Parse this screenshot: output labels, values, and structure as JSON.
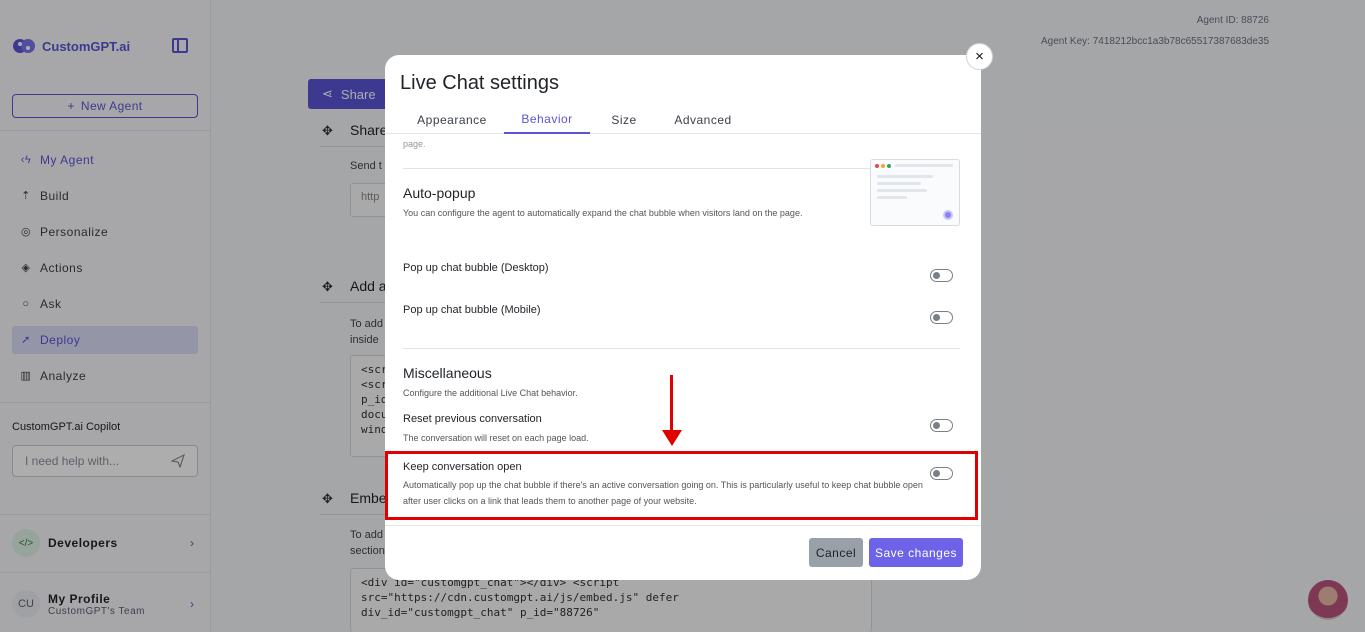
{
  "app": {
    "brand": "CustomGPT.ai",
    "accent": "#5a55d6"
  },
  "sidebar": {
    "new_agent": "New Agent",
    "nav": [
      {
        "label": "My Agent",
        "icon": "back-bolt-icon"
      },
      {
        "label": "Build",
        "icon": "build-icon"
      },
      {
        "label": "Personalize",
        "icon": "palette-icon"
      },
      {
        "label": "Actions",
        "icon": "actions-icon"
      },
      {
        "label": "Ask",
        "icon": "chat-icon"
      },
      {
        "label": "Deploy",
        "icon": "rocket-icon"
      },
      {
        "label": "Analyze",
        "icon": "chart-icon"
      }
    ],
    "copilot_title": "CustomGPT.ai Copilot",
    "copilot_placeholder": "I need help with...",
    "developers_badge": "</>",
    "developers": "Developers",
    "profile_initials": "CU",
    "profile_name": "My Profile",
    "profile_team": "CustomGPT's Team"
  },
  "header": {
    "agent_id": "Agent ID: 88726",
    "agent_key": "Agent Key: 7418212bcc1a3b78c65517387683de35"
  },
  "main": {
    "share_button": "Share",
    "section1_title": "Share",
    "section1_text": "Send t",
    "section1_input": "http",
    "section2_title": "Add a",
    "section2_text1": "To add",
    "section2_text2": "inside",
    "section2_code": [
      "<scri",
      "<scri",
      "p_id",
      "docu",
      "wind"
    ],
    "section3_title": "Embe",
    "section3_text1": "To add",
    "section3_text2": "section",
    "section3_code": [
      "<div id=\"customgpt_chat\"></div> <script",
      "src=\"https://cdn.customgpt.ai/js/embed.js\" defer",
      "div_id=\"customgpt_chat\" p_id=\"88726\""
    ]
  },
  "modal": {
    "title": "Live Chat settings",
    "tabs": [
      "Appearance",
      "Behavior",
      "Size",
      "Advanced"
    ],
    "active_tab": "Behavior",
    "faded_text": "page.",
    "autopopup": {
      "title": "Auto-popup",
      "description": "You can configure the agent to automatically expand the chat bubble when visitors land on the page.",
      "desktop_label": "Pop up chat bubble (Desktop)",
      "mobile_label": "Pop up chat bubble (Mobile)"
    },
    "misc": {
      "title": "Miscellaneous",
      "description": "Configure the additional Live Chat behavior.",
      "reset_label": "Reset previous conversation",
      "reset_desc": "The conversation will reset on each page load.",
      "keep_label": "Keep conversation open",
      "keep_desc": "Automatically pop up the chat bubble if there's an active conversation going on. This is particularly useful to keep chat bubble open after user clicks on a link that leads them to another page of your website."
    },
    "cancel": "Cancel",
    "save": "Save changes",
    "close_icon": "×"
  },
  "annotation_color": "#e10000"
}
